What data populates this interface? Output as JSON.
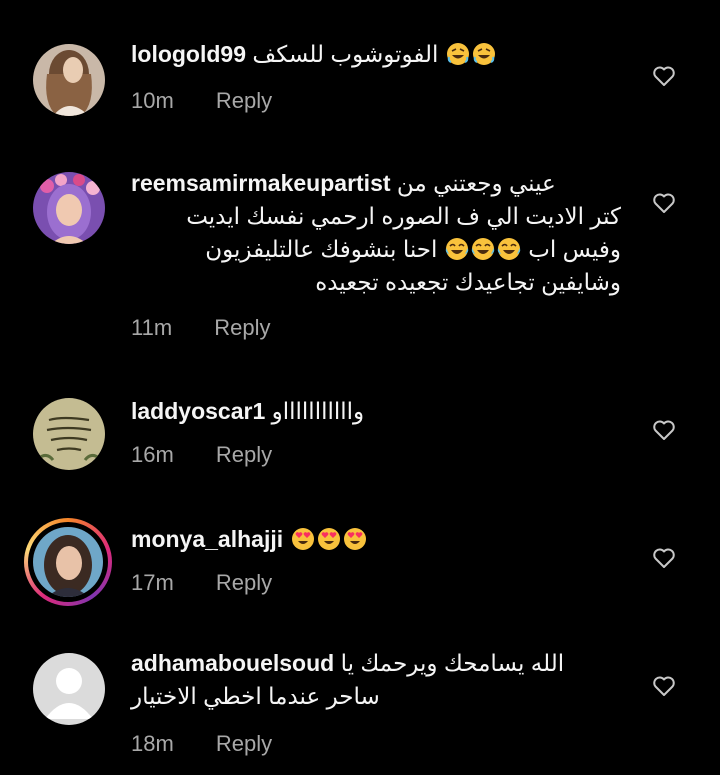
{
  "comments": [
    {
      "username": "lologold99",
      "text": "الفوتوشوب للسكف",
      "emojis": [
        "rofl-emoji",
        "rofl-emoji"
      ],
      "time": "10m",
      "reply": "Reply"
    },
    {
      "username": "reemsamirmakeupartist",
      "text_line1": "عيني وجعتني من",
      "text_line2": "كتر الاديت الي ف الصوره ارحمي نفسك ايديت",
      "text_line3a": "وفيس اب",
      "text_line3b": "احنا بنشوفك عالتليفزيون",
      "text_line4": "وشايفين تجاعيدك تجعيده تجعيده",
      "emojis": [
        "joy-emoji",
        "joy-emoji",
        "joy-emoji"
      ],
      "time": "11m",
      "reply": "Reply"
    },
    {
      "username": "laddyoscar1",
      "text": "واااااااااااو",
      "time": "16m",
      "reply": "Reply"
    },
    {
      "username": "monya_alhajji",
      "emojis": [
        "heart-eyes-emoji",
        "heart-eyes-emoji",
        "heart-eyes-emoji"
      ],
      "time": "17m",
      "reply": "Reply"
    },
    {
      "username": "adhamabouelsoud",
      "text_line1": "الله يسامحك ويرحمك يا",
      "text_line2": "ساحر عندما اخطي الاختيار",
      "time": "18m",
      "reply": "Reply"
    }
  ],
  "colors": {
    "background": "#000000",
    "text": "#f5f5f5",
    "muted": "#a8a8a8",
    "emoji_yellow": "#f9c23c",
    "heart_red": "#f92f60"
  }
}
